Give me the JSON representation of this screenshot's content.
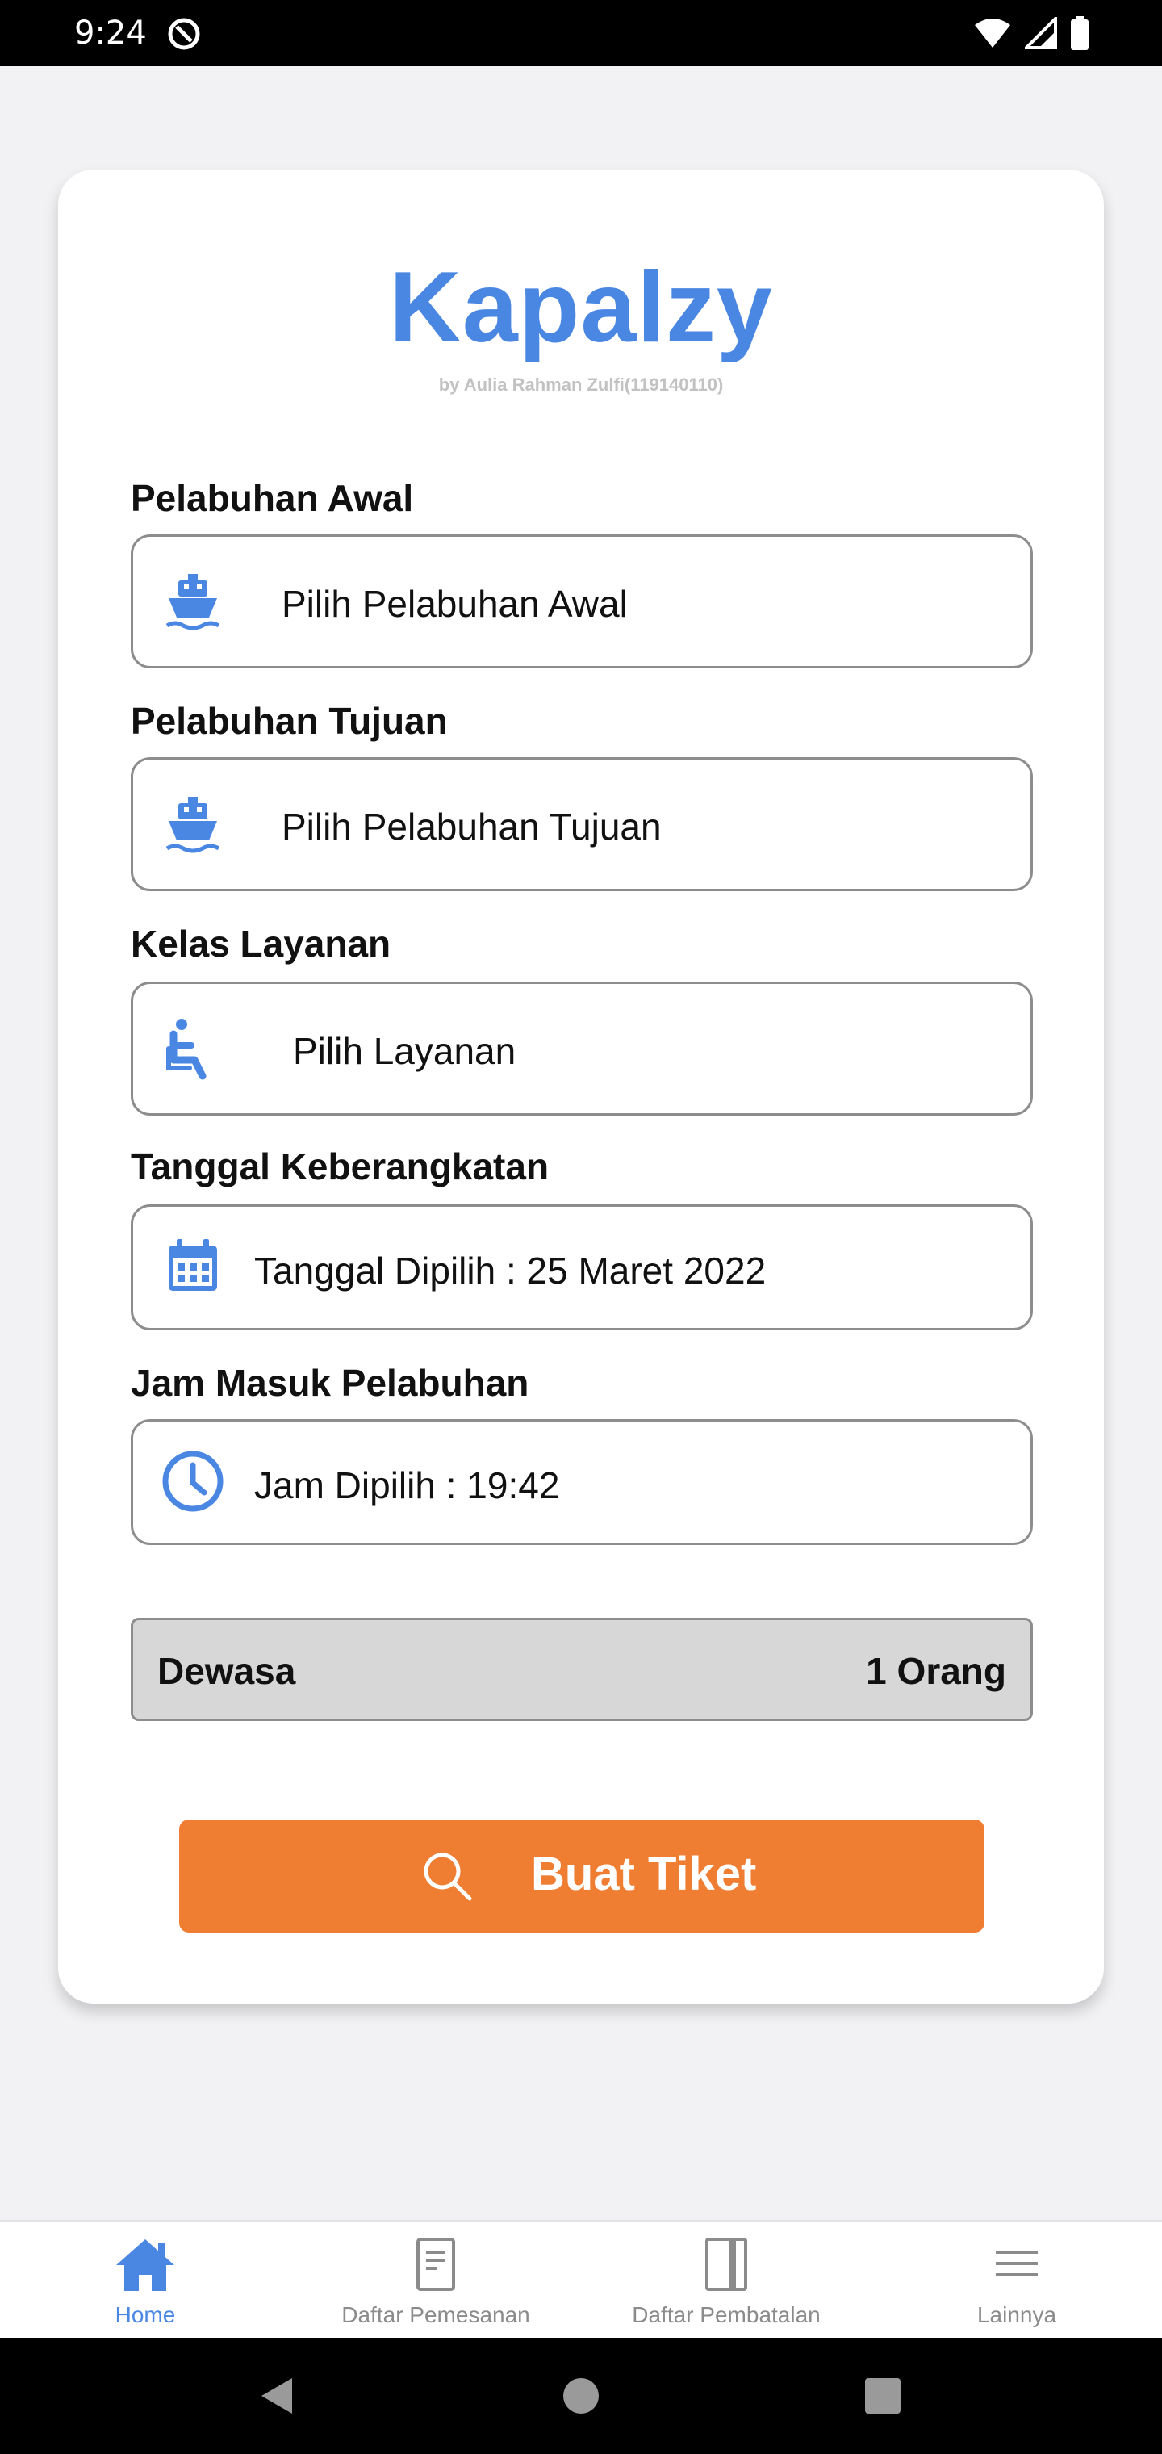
{
  "status_bar": {
    "time": "9:24"
  },
  "app": {
    "title": "Kapalzy",
    "subtitle": "by Aulia Rahman Zulfi(119140110)",
    "accent_color": "#4a87e3",
    "button_color": "#ef7d32"
  },
  "form": {
    "origin": {
      "label": "Pelabuhan Awal",
      "value": "Pilih Pelabuhan Awal",
      "icon": "ship-icon"
    },
    "destination": {
      "label": "Pelabuhan Tujuan",
      "value": "Pilih Pelabuhan Tujuan",
      "icon": "ship-icon"
    },
    "service_class": {
      "label": "Kelas Layanan",
      "value": "Pilih Layanan",
      "icon": "seat-icon"
    },
    "date": {
      "label": "Tanggal Keberangkatan",
      "value": "Tanggal Dipilih : 25 Maret 2022",
      "icon": "calendar-icon"
    },
    "time": {
      "label": "Jam Masuk Pelabuhan",
      "value": "Jam Dipilih : 19:42",
      "icon": "clock-icon"
    },
    "passenger": {
      "type": "Dewasa",
      "count": "1 Orang"
    },
    "submit_label": "Buat Tiket"
  },
  "bottom_nav": {
    "items": [
      {
        "label": "Home",
        "icon": "home-icon",
        "active": true
      },
      {
        "label": "Daftar Pemesanan",
        "icon": "document-icon",
        "active": false
      },
      {
        "label": "Daftar Pembatalan",
        "icon": "book-icon",
        "active": false
      },
      {
        "label": "Lainnya",
        "icon": "menu-icon",
        "active": false
      }
    ]
  }
}
